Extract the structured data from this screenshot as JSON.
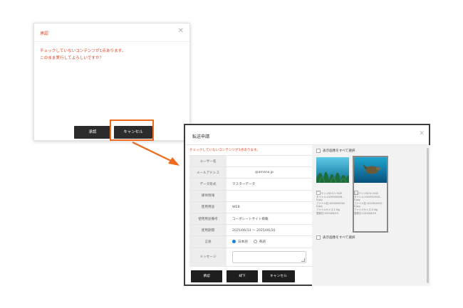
{
  "confirm_dialog": {
    "title": "承認",
    "close_glyph": "✕",
    "message_line1": "チェックしていないコンテンツが1点あります。",
    "message_line2": "このまま実行してよろしいですか？",
    "ok_label": "承認",
    "cancel_label": "キャンセル"
  },
  "request_dialog": {
    "title": "転送申請",
    "close_glyph": "✕",
    "warning": "チェックしていないコンテンツが1点あります。",
    "fields": [
      {
        "label": "ユーザー名",
        "value": ""
      },
      {
        "label": "メールアドレス",
        "value": "@amana.jp"
      },
      {
        "label": "データ形式",
        "value": "マスターデータ"
      },
      {
        "label": "媒体情報",
        "value": ""
      },
      {
        "label": "使用用途",
        "value": "WEB"
      },
      {
        "label": "使用用途備考",
        "value": "コーポレートサイト掲載"
      },
      {
        "label": "使用期間",
        "value": "2025/06/13 ～ 2025/06/20"
      }
    ],
    "language": {
      "label": "言語",
      "options": [
        "日本語",
        "英語"
      ],
      "selected": "日本語"
    },
    "message_label": "メッセージ",
    "buttons": {
      "approve": "承認",
      "reject": "却下",
      "cancel": "キャンセル"
    },
    "select_all_top": "表示画像をすべて選択",
    "select_all_bottom": "表示画像をすべて選択",
    "cards": [
      {
        "checked": true,
        "meta": [
          "コンテンツID:12 / KGE",
          "タイトル:1020000026…",
          "0.jpg",
          "ファイル名:1020000026",
          "0.jpg",
          "ファイルサイズ:1 Mg",
          "登録日:2015/06/19"
        ]
      },
      {
        "checked": false,
        "meta": [
          "コンテンツID:4 / KGE",
          "タイトル:1024910022…",
          "0.jpg",
          "ファイル名:1024910022",
          "0.jpg",
          "ファイルサイズ:2 Mg",
          "登録日:2015/06/19"
        ]
      }
    ]
  },
  "colors": {
    "accent_red": "#e0401c",
    "highlight_orange": "#f06a1d",
    "button_dark": "#1e1e1e",
    "radio_blue": "#1a7fd4"
  }
}
